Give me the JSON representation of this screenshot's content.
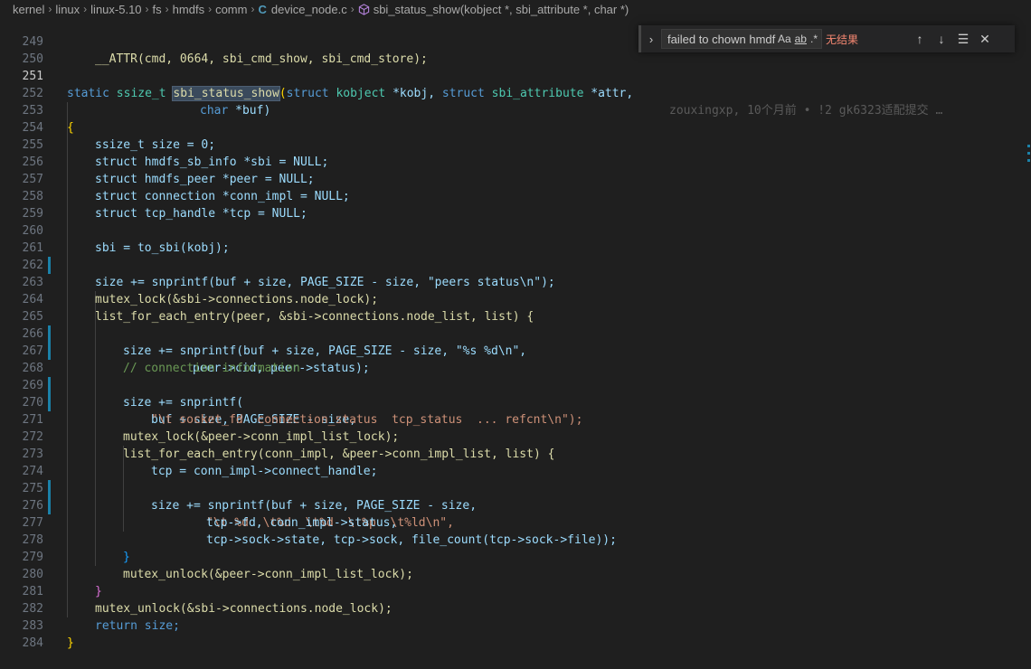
{
  "breadcrumb": {
    "items": [
      "kernel",
      "linux",
      "linux-5.10",
      "fs",
      "hmdfs",
      "comm",
      "device_node.c",
      "sbi_status_show(kobject *, sbi_attribute *, char *)"
    ]
  },
  "find": {
    "query": "failed to chown hmdf",
    "match_case": "Aa",
    "whole_word": "ab",
    "regex": ".*",
    "result": "无结果"
  },
  "blame": "zouxingxp, 10个月前 • !2 gk6323适配提交 …",
  "lines": [
    "249",
    "250",
    "251",
    "252",
    "253",
    "254",
    "255",
    "256",
    "257",
    "258",
    "259",
    "260",
    "261",
    "262",
    "263",
    "264",
    "265",
    "266",
    "267",
    "268",
    "269",
    "270",
    "271",
    "272",
    "273",
    "274",
    "275",
    "276",
    "277",
    "278",
    "279",
    "280",
    "281",
    "282",
    "283",
    "284"
  ],
  "code": {
    "l249": "__ATTR(cmd, 0664, sbi_cmd_show, sbi_cmd_store);",
    "l251_kw": "static",
    "l251_type": "ssize_t",
    "l251_fn": "sbi_status_show",
    "l251_rest1": "struct",
    "l251_t1": "kobject",
    "l251_v1": "*kobj,",
    "l251_rest2": "struct",
    "l251_t2": "sbi_attribute",
    "l251_v2": "*attr,",
    "l252_t": "char",
    "l252_v": "*buf)",
    "l254": "ssize_t size = 0;",
    "l255": "struct hmdfs_sb_info *sbi = NULL;",
    "l256": "struct hmdfs_peer *peer = NULL;",
    "l257": "struct connection *conn_impl = NULL;",
    "l258": "struct tcp_handle *tcp = NULL;",
    "l260": "sbi = to_sbi(kobj);",
    "l261": "size += snprintf(buf + size, PAGE_SIZE - size, \"peers status\\n\");",
    "l263": "mutex_lock(&sbi->connections.node_lock);",
    "l264": "list_for_each_entry(peer, &sbi->connections.node_list, list) {",
    "l265": "size += snprintf(buf + size, PAGE_SIZE - size, \"%s %d\\n\",",
    "l266": "peer->cid, peer->status);",
    "l267": "// connection information",
    "l268": "size += snprintf(",
    "l269": "buf + size, PAGE_SIZE - size,",
    "l270": "\"\\t socket_fd  connection_status  tcp_status  ... refcnt\\n\");",
    "l271": "mutex_lock(&peer->conn_impl_list_lock);",
    "l272": "list_for_each_entry(conn_impl, &peer->conn_impl_list, list) {",
    "l273": "tcp = conn_impl->connect_handle;",
    "l274": "size += snprintf(buf + size, PAGE_SIZE - size,",
    "l275": "\"\\t %d  \\t%d  \\t%d  \\t%p  \\t%ld\\n\",",
    "l276": "tcp->fd, conn_impl->status,",
    "l277": "tcp->sock->state, tcp->sock, file_count(tcp->sock->file));",
    "l278": "}",
    "l279": "mutex_unlock(&peer->conn_impl_list_lock);",
    "l280": "}",
    "l281": "mutex_unlock(&sbi->connections.node_lock);",
    "l282": "return size;",
    "l283": "}",
    "l253": "{"
  }
}
